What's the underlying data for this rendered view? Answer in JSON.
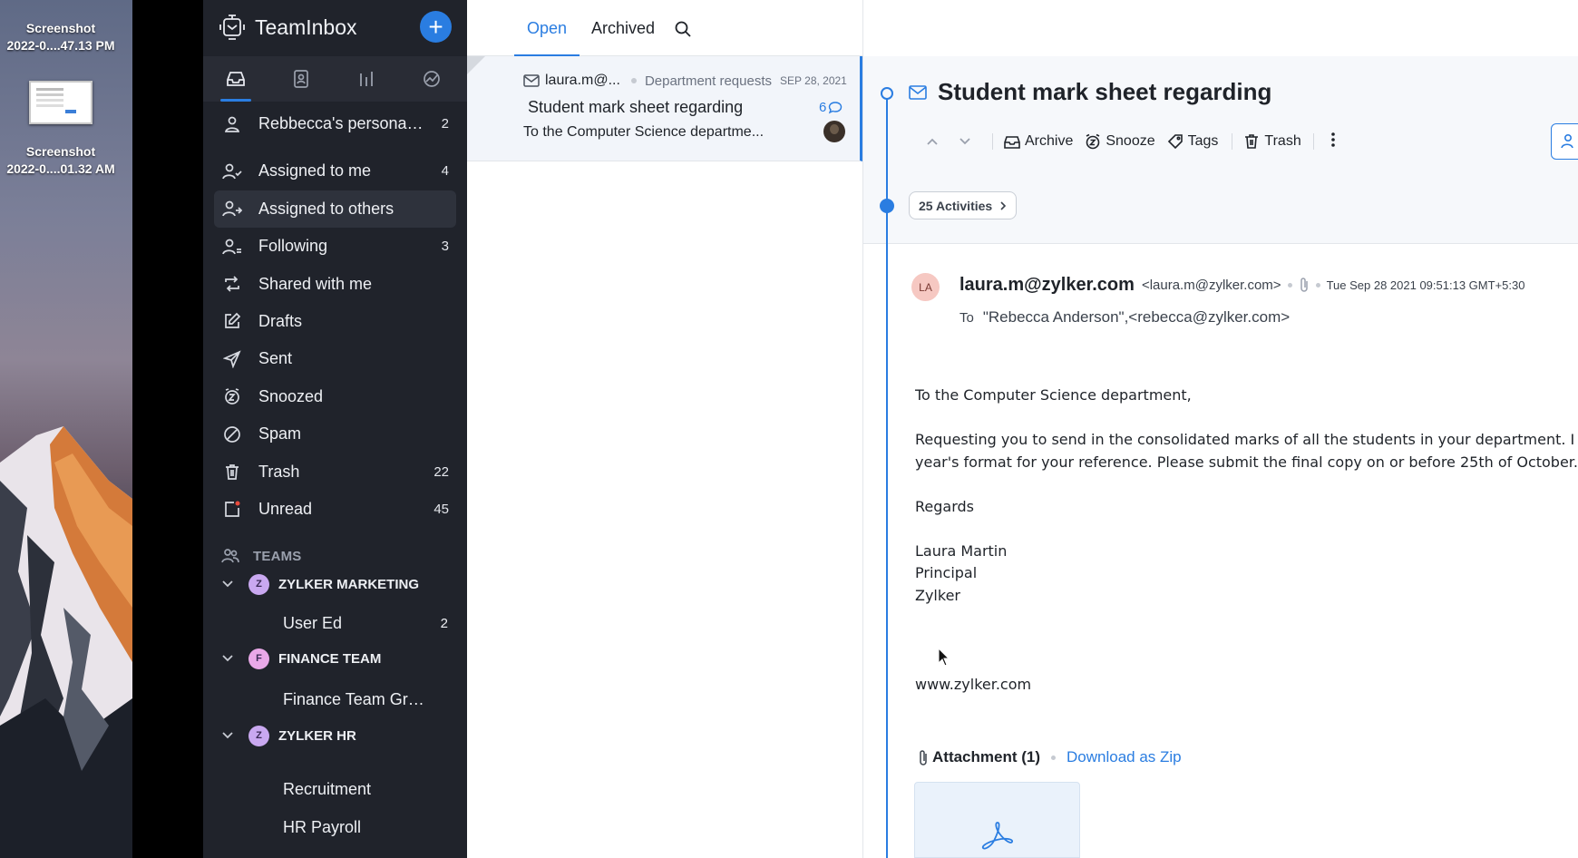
{
  "desktop": {
    "icons": [
      {
        "line1": "Screenshot",
        "line2": "2022-0....47.13 PM"
      },
      {
        "line1": "Screenshot",
        "line2": "2022-0....01.32 AM"
      }
    ]
  },
  "app": {
    "name": "TeamInbox",
    "new_label": "+"
  },
  "sidebar": {
    "items": [
      {
        "label": "Rebbecca's personal in...",
        "count": "2"
      },
      {
        "label": "Assigned to me",
        "count": "4"
      },
      {
        "label": "Assigned to others",
        "count": ""
      },
      {
        "label": "Following",
        "count": "3"
      },
      {
        "label": "Shared with me",
        "count": ""
      },
      {
        "label": "Drafts",
        "count": ""
      },
      {
        "label": "Sent",
        "count": ""
      },
      {
        "label": "Snoozed",
        "count": ""
      },
      {
        "label": "Spam",
        "count": ""
      },
      {
        "label": "Trash",
        "count": "22"
      },
      {
        "label": "Unread",
        "count": "45"
      }
    ],
    "teams_header": "TEAMS",
    "teams": [
      {
        "initial": "Z",
        "name": "ZYLKER MARKETING",
        "color": "#c9a8f0",
        "subs": [
          {
            "label": "User Ed",
            "count": "2"
          }
        ]
      },
      {
        "initial": "F",
        "name": "FINANCE TEAM",
        "color": "#e9a8e8",
        "subs": [
          {
            "label": "Finance Team Grou...",
            "count": ""
          }
        ]
      },
      {
        "initial": "Z",
        "name": "ZYLKER HR",
        "color": "#c9a8f0",
        "subs": [
          {
            "label": "Recruitment",
            "count": ""
          },
          {
            "label": "HR Payroll",
            "count": ""
          }
        ]
      }
    ]
  },
  "list": {
    "tabs": [
      "Open",
      "Archived"
    ],
    "item": {
      "from": "laura.m@...",
      "department": "Department requests",
      "date": "SEP 28, 2021",
      "subject": "Student mark sheet regarding",
      "count": "6",
      "preview": "To the Computer Science departme..."
    }
  },
  "reader": {
    "subject": "Student mark sheet regarding",
    "toolbar": {
      "archive": "Archive",
      "snooze": "Snooze",
      "tags": "Tags",
      "trash": "Trash"
    },
    "activities": "25 Activities",
    "sender": {
      "initials": "LA",
      "name": "laura.m@zylker.com",
      "email": "<laura.m@zylker.com>",
      "time": "Tue Sep 28 2021 09:51:13 GMT+5:30"
    },
    "to_label": "To",
    "to": "\"Rebecca Anderson\",<rebecca@zylker.com>",
    "body": {
      "greeting": "To the Computer Science department,",
      "line1": "Requesting you to send in the consolidated marks of all the students in your department. I have attached last",
      "line2": "year's format for your reference. Please submit the final copy on or before 25th of October.",
      "regards": "Regards",
      "name": "Laura Martin",
      "role": "Principal",
      "org": "Zylker",
      "website": "www.zylker.com"
    },
    "attachment_label": "Attachment (1)",
    "download_label": "Download as Zip"
  },
  "colors": {
    "accent": "#2a7de1",
    "sidebar_bg": "#20232b"
  }
}
